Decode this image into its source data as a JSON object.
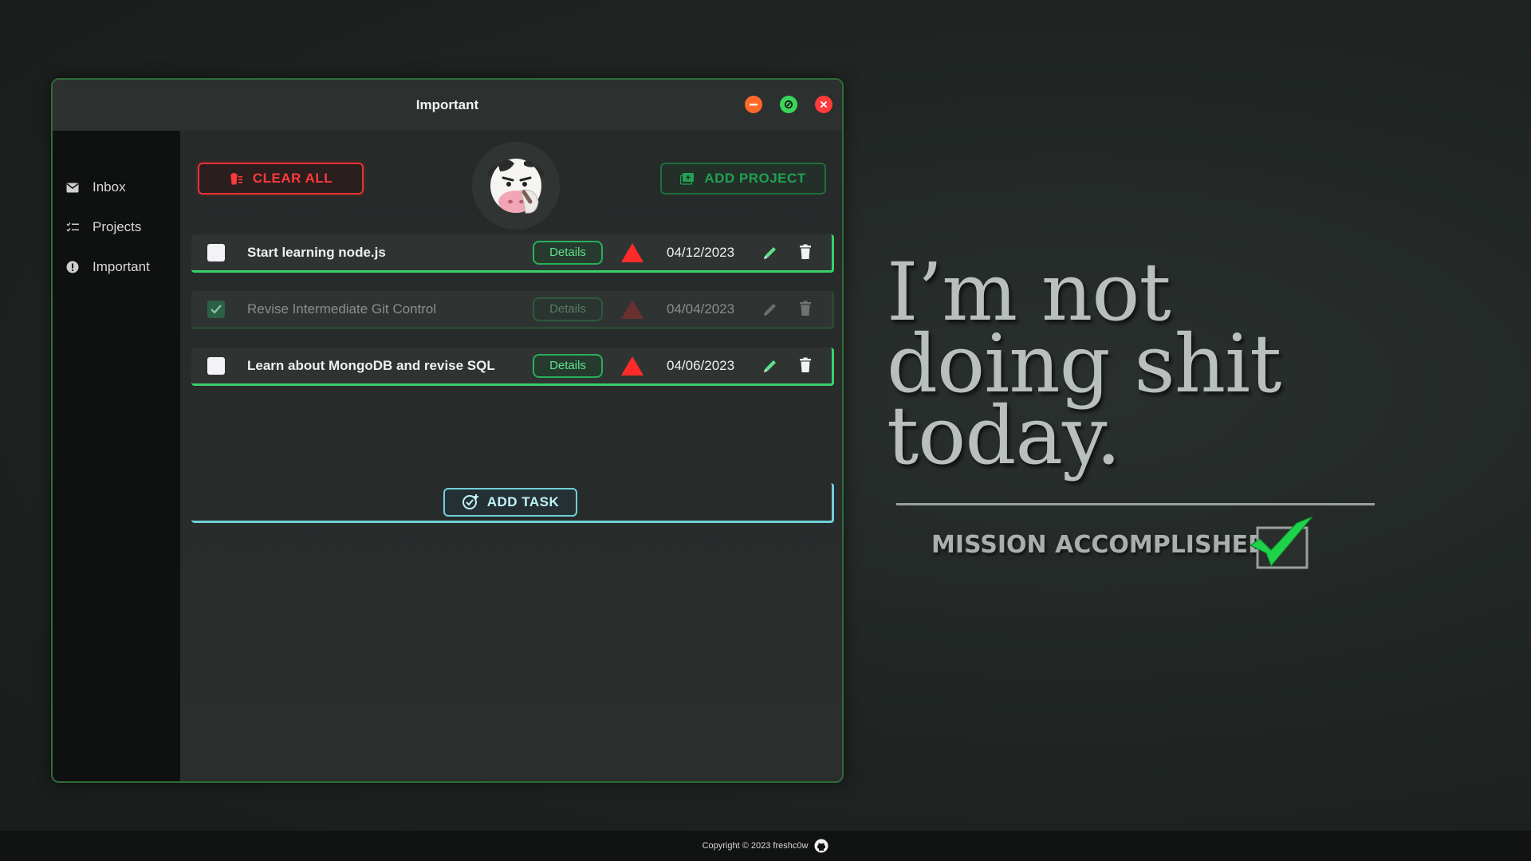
{
  "window": {
    "title": "Important"
  },
  "sidebar": {
    "items": [
      {
        "label": "Inbox",
        "icon": "mail-icon"
      },
      {
        "label": "Projects",
        "icon": "checklist-icon"
      },
      {
        "label": "Important",
        "icon": "alert-icon"
      }
    ]
  },
  "toolbar": {
    "clear_label": "CLEAR ALL",
    "add_project_label": "ADD PROJECT"
  },
  "tasks": [
    {
      "title": "Start learning node.js",
      "details_label": "Details",
      "due": "04/12/2023",
      "completed": false
    },
    {
      "title": "Revise Intermediate Git Control",
      "details_label": "Details",
      "due": "04/04/2023",
      "completed": true
    },
    {
      "title": "Learn about MongoDB and revise SQL",
      "details_label": "Details",
      "due": "04/06/2023",
      "completed": false
    }
  ],
  "add_task_label": "ADD TASK",
  "quote": {
    "line1": "I’m not",
    "line2": "doing shit",
    "line3": "today."
  },
  "mission": "MISSION ACCOMPLISHED",
  "footer": {
    "copyright": "Copyright © 2023 freshc0w"
  },
  "colors": {
    "accent_green": "#3bd16a",
    "danger_red": "#ff3a3a",
    "add_task_cyan": "#6fd0d8",
    "close": "#ff3b3b",
    "minimize": "#ff6a2a",
    "maximize": "#39d65a"
  }
}
